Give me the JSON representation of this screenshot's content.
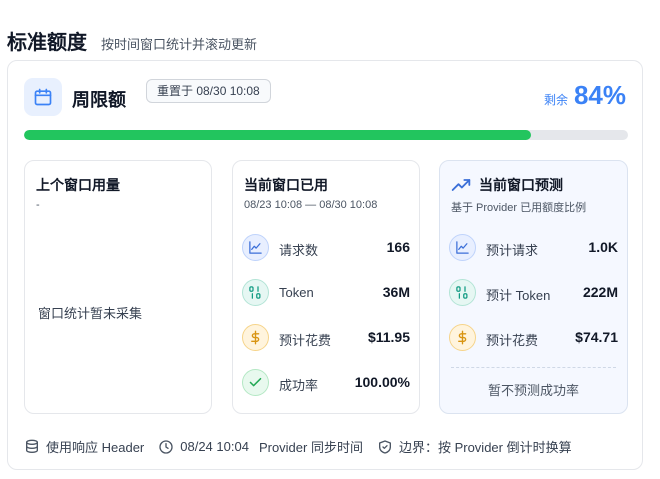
{
  "header": {
    "title": "标准额度",
    "subtitle": "按时间窗口统计并滚动更新"
  },
  "card": {
    "period_title": "周限额",
    "reset_badge": "重置于 08/30 10:08",
    "remaining_label": "剩余",
    "remaining_pct": "84%",
    "progress_used_fraction": 0.84,
    "progress_color": "#22c55e",
    "accent_color": "#3b82f6"
  },
  "panels": {
    "previous": {
      "title": "上个窗口用量",
      "subtitle": "-",
      "empty_note": "窗口统计暂未采集"
    },
    "current": {
      "title": "当前窗口已用",
      "subtitle": "08/23 10:08 — 08/30 10:08",
      "metrics": [
        {
          "label": "请求数",
          "value": "166",
          "icon": "chart-line-icon"
        },
        {
          "label": "Token",
          "value": "36M",
          "icon": "binary-icon"
        },
        {
          "label": "预计花费",
          "value": "$11.95",
          "icon": "dollar-icon"
        },
        {
          "label": "成功率",
          "value": "100.00%",
          "icon": "check-icon"
        }
      ]
    },
    "forecast": {
      "title": "当前窗口预测",
      "subtitle": "基于 Provider 已用额度比例",
      "metrics": [
        {
          "label": "预计请求",
          "value": "1.0K",
          "icon": "chart-line-icon"
        },
        {
          "label": "预计 Token",
          "value": "222M",
          "icon": "binary-icon"
        },
        {
          "label": "预计花费",
          "value": "$74.71",
          "icon": "dollar-icon"
        }
      ],
      "no_predict_note": "暂不预测成功率"
    }
  },
  "footer": {
    "source": "使用响应 Header",
    "sync_time": "08/24 10:04",
    "sync_label": "Provider 同步时间",
    "boundary": "边界：按 Provider 倒计时换算"
  }
}
